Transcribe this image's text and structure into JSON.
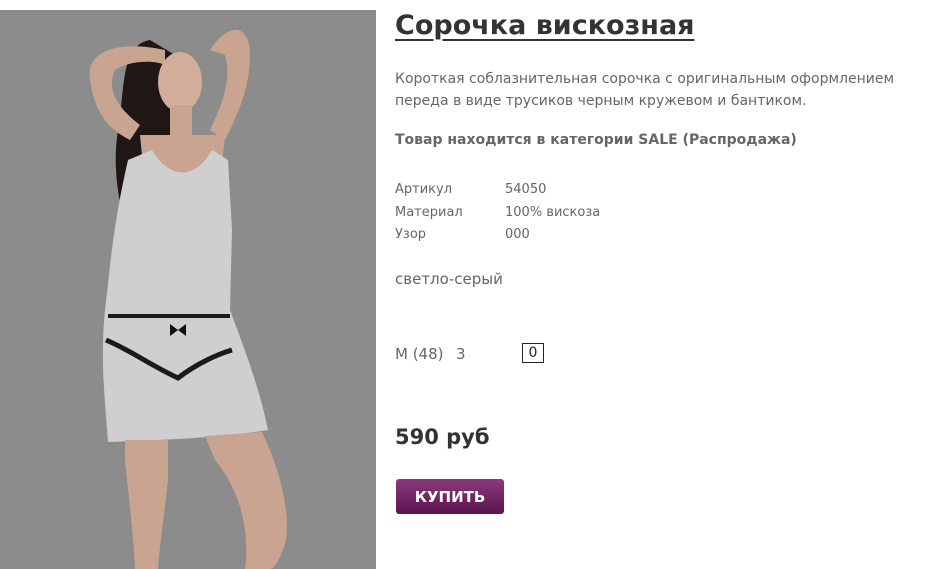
{
  "product": {
    "title": "Сорочка вискозная",
    "description": "Короткая соблазнительная сорочка с оригинальным оформлением переда в виде трусиков черным кружевом и бантиком.",
    "category_note": "Товар находится в категории SALE (Распродажа)",
    "specs": [
      {
        "label": "Артикул",
        "value": "54050"
      },
      {
        "label": "Материал",
        "value": "100% вискоза"
      },
      {
        "label": "Узор",
        "value": "000"
      }
    ],
    "color": "светло-серый",
    "size": {
      "label": "M (48)",
      "stock": "3",
      "quantity": "0"
    },
    "price": "590 руб",
    "buy_label": "КУПИТЬ"
  },
  "colors": {
    "photo_background": "#8a8a8a",
    "garment": "#cfcfd1",
    "button_top": "#8a3a7c",
    "button_bottom": "#5c1450"
  },
  "icons": {
    "photo": "model-photo"
  }
}
